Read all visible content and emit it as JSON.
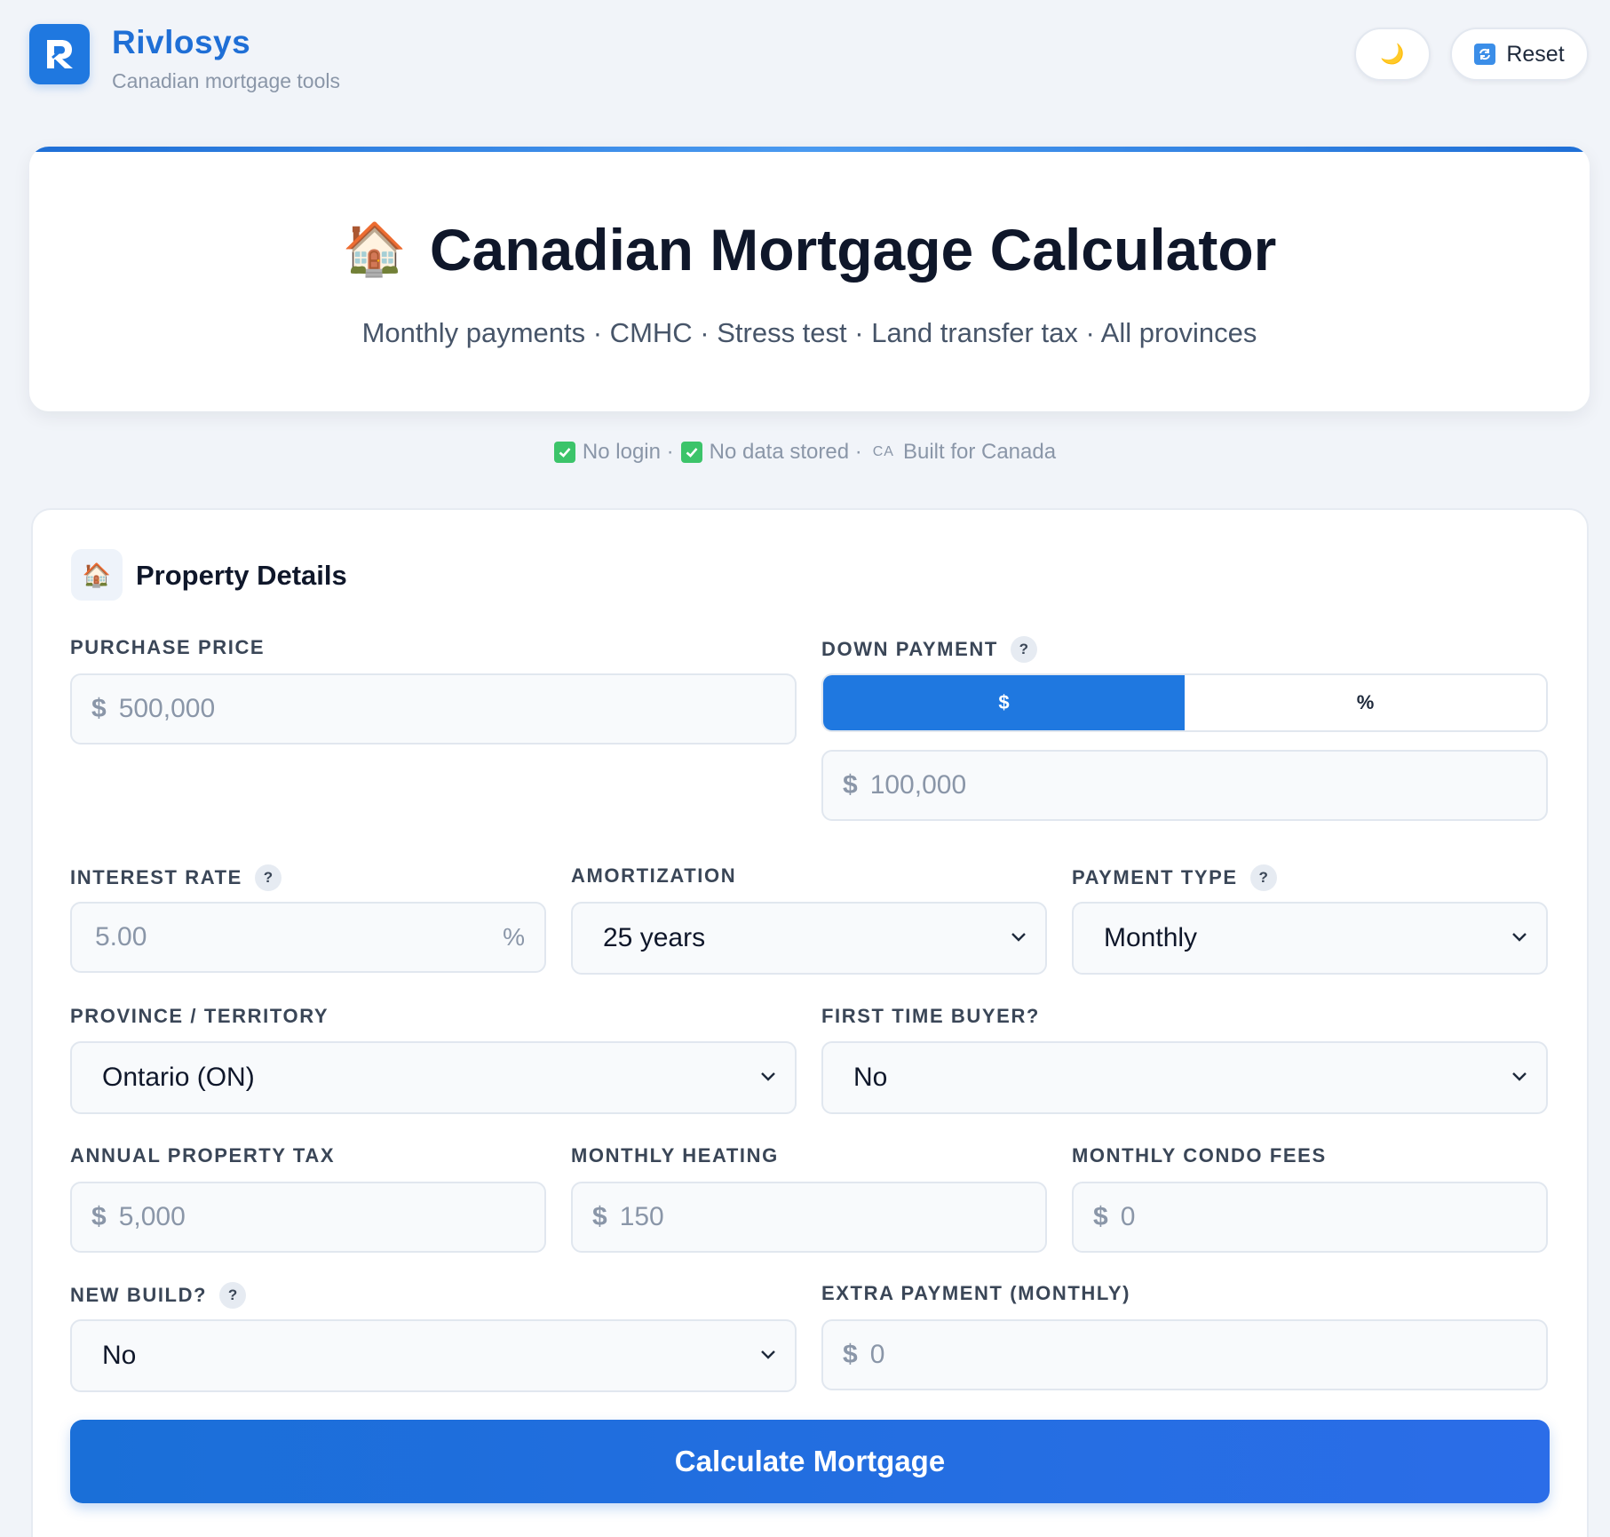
{
  "header": {
    "brand_name": "Rivlosys",
    "brand_tagline": "Canadian mortgage tools",
    "theme_icon": "🌙",
    "reset_label": "Reset"
  },
  "hero": {
    "icon": "🏠",
    "title": "Canadian Mortgage Calculator",
    "subtitle": "Monthly payments · CMHC · Stress test · Land transfer tax · All provinces"
  },
  "trust": {
    "no_login": "No login ·",
    "no_data": "No data stored ·",
    "flag": "CA",
    "built_for": "Built for Canada"
  },
  "section": {
    "icon": "🏠",
    "title": "Property Details"
  },
  "fields": {
    "purchase_price": {
      "label": "PURCHASE PRICE",
      "currency": "$",
      "placeholder": "500,000"
    },
    "down_payment": {
      "label": "DOWN PAYMENT",
      "help": "?",
      "toggle": [
        "$",
        "%"
      ],
      "toggle_selected": "$",
      "currency": "$",
      "placeholder": "100,000"
    },
    "interest_rate": {
      "label": "INTEREST RATE",
      "help": "?",
      "placeholder": "5.00",
      "suffix": "%"
    },
    "amortization": {
      "label": "AMORTIZATION",
      "value": "25 years"
    },
    "payment_type": {
      "label": "PAYMENT TYPE",
      "help": "?",
      "value": "Monthly"
    },
    "province": {
      "label": "PROVINCE / TERRITORY",
      "value": "Ontario (ON)"
    },
    "first_time_buyer": {
      "label": "FIRST TIME BUYER?",
      "value": "No"
    },
    "property_tax": {
      "label": "ANNUAL PROPERTY TAX",
      "currency": "$",
      "placeholder": "5,000"
    },
    "heating": {
      "label": "MONTHLY HEATING",
      "currency": "$",
      "placeholder": "150"
    },
    "condo_fees": {
      "label": "MONTHLY CONDO FEES",
      "currency": "$",
      "placeholder": "0"
    },
    "new_build": {
      "label": "NEW BUILD?",
      "help": "?",
      "value": "No"
    },
    "extra_payment": {
      "label": "EXTRA PAYMENT (MONTHLY)",
      "currency": "$",
      "placeholder": "0"
    }
  },
  "actions": {
    "calculate_label": "Calculate Mortgage"
  },
  "colors": {
    "accent": "#1f78e0",
    "brand_text": "#1f6fd6",
    "background": "#f1f4f9",
    "check_green": "#3cc46a"
  }
}
